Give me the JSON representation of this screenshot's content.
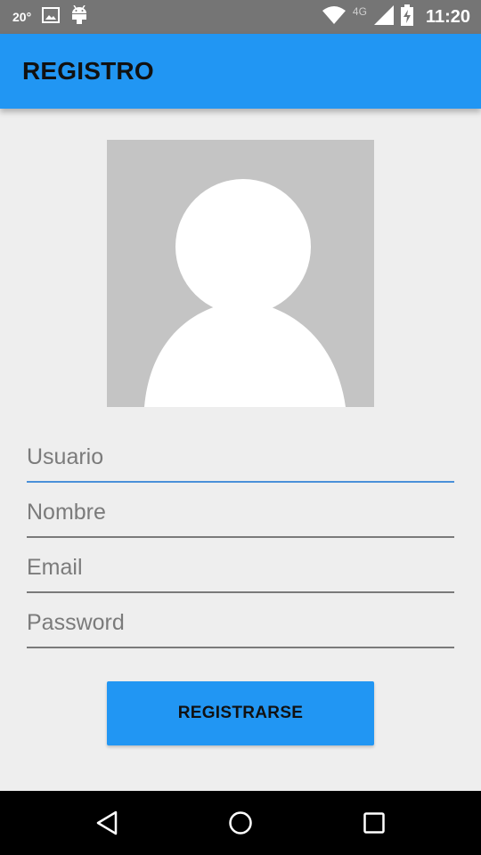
{
  "status_bar": {
    "temperature": "20°",
    "network": "4G",
    "time": "11:20",
    "icons": [
      "image-icon",
      "android-icon",
      "wifi-icon",
      "signal-icon",
      "battery-charging-icon"
    ]
  },
  "app_bar": {
    "title": "REGISTRO",
    "color": "#2196f3"
  },
  "avatar": {
    "icon": "default-user-avatar-icon",
    "background": "#c4c4c4"
  },
  "form": {
    "usuario_placeholder": "Usuario",
    "nombre_placeholder": "Nombre",
    "email_placeholder": "Email",
    "password_placeholder": "Password",
    "active_field": "Usuario"
  },
  "submit": {
    "label": "REGISTRARSE"
  },
  "nav_bar": {
    "icons": [
      "back-icon",
      "home-icon",
      "recents-icon"
    ]
  }
}
